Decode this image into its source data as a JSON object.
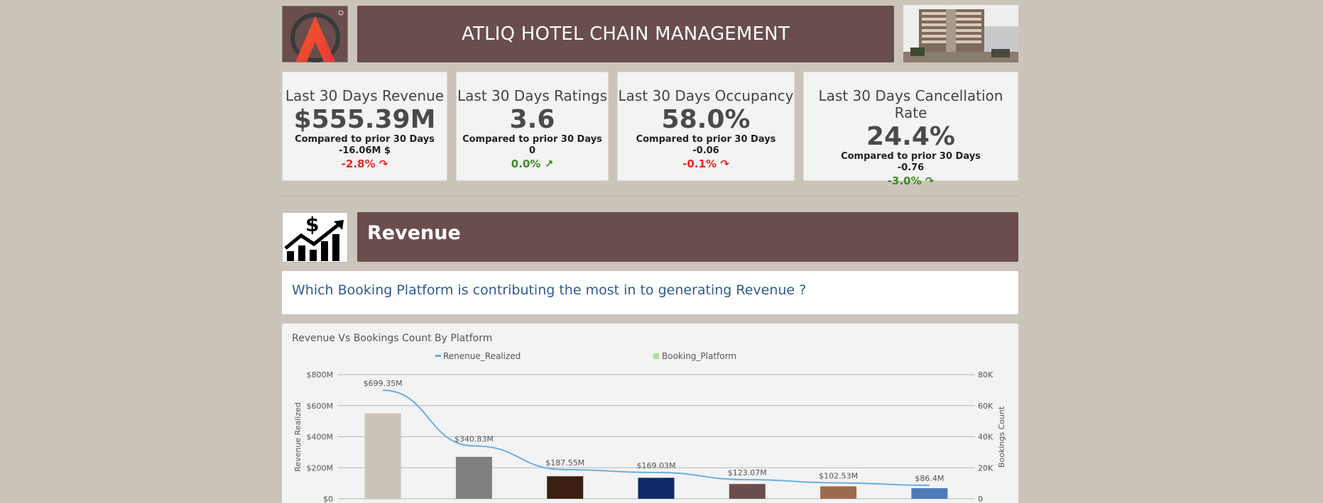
{
  "header": {
    "title": "ATLIQ HOTEL CHAIN MANAGEMENT",
    "brand_color": "#6a4d4d"
  },
  "kpis": [
    {
      "title": "Last 30 Days Revenue",
      "value": "$555.39M",
      "compare": "Compared to prior 30 Days",
      "diff": "-16.06M $",
      "pct": "-2.8% ↷",
      "pct_color": "#e8261e"
    },
    {
      "title": "Last 30 Days Ratings",
      "value": "3.6",
      "compare": "Compared to prior 30 Days",
      "diff": "0",
      "pct": "0.0% ↗",
      "pct_color": "#3b8a24"
    },
    {
      "title": "Last 30 Days Occupancy",
      "value": "58.0%",
      "compare": "Compared to prior 30 Days",
      "diff": "-0.06",
      "pct": "-0.1% ↷",
      "pct_color": "#e8261e"
    },
    {
      "title": "Last 30 Days Cancellation Rate",
      "value": "24.4%",
      "compare": "Compared to prior 30 Days",
      "diff": "-0.76",
      "pct": "-3.0% ↷",
      "pct_color": "#3b8a24"
    }
  ],
  "section": {
    "title": "Revenue",
    "question": "Which Booking Platform is contributing the most in to generating Revenue ?"
  },
  "chart_data": {
    "type": "bar",
    "title": "Revenue Vs Bookings Count By Platform",
    "legend": [
      "Renenue_Realized",
      "Booking_Platform"
    ],
    "legend_placement": "top",
    "ylabel": "Revenue Realized",
    "y2label": "Bookings Count",
    "yticks": [
      "$0",
      "$200M",
      "$400M",
      "$600M",
      "$800M"
    ],
    "y2ticks": [
      "0",
      "20K",
      "40K",
      "60K",
      "80K"
    ],
    "ylim": [
      0,
      800
    ],
    "y2lim": [
      0,
      80000
    ],
    "series": [
      {
        "name": "Renenue_Realized",
        "type": "line",
        "values": [
          699.35,
          340.83,
          187.55,
          169.03,
          123.07,
          102.53,
          86.4
        ],
        "labels": [
          "$699.35M",
          "$340.83M",
          "$187.55M",
          "$169.03M",
          "$123.07M",
          "$102.53M",
          "$86.4M"
        ],
        "color": "#6aaee0"
      },
      {
        "name": "Booking_Platform",
        "type": "bar",
        "values": [
          55000,
          27000,
          14500,
          13500,
          9500,
          8000,
          6800
        ],
        "colors": [
          "#cbc4ba",
          "#808080",
          "#3a1f12",
          "#0f2a66",
          "#6a4d4d",
          "#9c6b4e",
          "#4f7ab8"
        ]
      }
    ],
    "grid": true
  }
}
